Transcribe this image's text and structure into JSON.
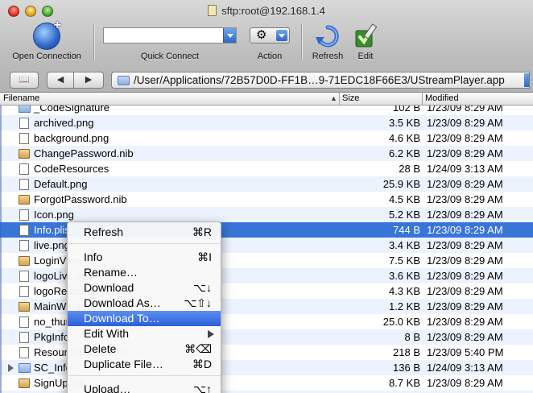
{
  "window": {
    "title": "sftp:root@192.168.1.4"
  },
  "toolbar": {
    "open_connection": "Open Connection",
    "quick_connect": "Quick Connect",
    "quick_connect_value": "",
    "action": "Action",
    "refresh": "Refresh",
    "edit": "Edit"
  },
  "pathbar": {
    "path": "/User/Applications/72B57D0D-FF1B…9-71EDC18F66E3/UStreamPlayer.app"
  },
  "columns": {
    "filename": "Filename",
    "size": "Size",
    "modified": "Modified"
  },
  "files": [
    {
      "name": "_CodeSignature",
      "size": "102 B",
      "modified": "1/23/09 8:29 AM",
      "kind": "folder"
    },
    {
      "name": "archived.png",
      "size": "3.5 KB",
      "modified": "1/23/09 8:29 AM",
      "kind": "file"
    },
    {
      "name": "background.png",
      "size": "4.6 KB",
      "modified": "1/23/09 8:29 AM",
      "kind": "file"
    },
    {
      "name": "ChangePassword.nib",
      "size": "6.2 KB",
      "modified": "1/23/09 8:29 AM",
      "kind": "nib"
    },
    {
      "name": "CodeResources",
      "size": "28 B",
      "modified": "1/24/09 3:13 AM",
      "kind": "file"
    },
    {
      "name": "Default.png",
      "size": "25.9 KB",
      "modified": "1/23/09 8:29 AM",
      "kind": "file"
    },
    {
      "name": "ForgotPassword.nib",
      "size": "4.5 KB",
      "modified": "1/23/09 8:29 AM",
      "kind": "nib"
    },
    {
      "name": "Icon.png",
      "size": "5.2 KB",
      "modified": "1/23/09 8:29 AM",
      "kind": "file"
    },
    {
      "name": "Info.plist",
      "size": "744 B",
      "modified": "1/23/09 8:29 AM",
      "kind": "file",
      "selected": true
    },
    {
      "name": "live.png",
      "size": "3.4 KB",
      "modified": "1/23/09 8:29 AM",
      "kind": "file"
    },
    {
      "name": "LoginView.nib",
      "size": "7.5 KB",
      "modified": "1/23/09 8:29 AM",
      "kind": "nib"
    },
    {
      "name": "logoLive.png",
      "size": "3.6 KB",
      "modified": "1/23/09 8:29 AM",
      "kind": "file"
    },
    {
      "name": "logoRecorded.png",
      "size": "4.3 KB",
      "modified": "1/23/09 8:29 AM",
      "kind": "file"
    },
    {
      "name": "MainWindow.nib",
      "size": "1.2 KB",
      "modified": "1/23/09 8:29 AM",
      "kind": "nib"
    },
    {
      "name": "no_thumbnail.png",
      "size": "25.0 KB",
      "modified": "1/23/09 8:29 AM",
      "kind": "file"
    },
    {
      "name": "PkgInfo",
      "size": "8 B",
      "modified": "1/23/09 8:29 AM",
      "kind": "file"
    },
    {
      "name": "ResourceRules.plist",
      "size": "218 B",
      "modified": "1/23/09 5:40 PM",
      "kind": "file"
    },
    {
      "name": "SC_Info",
      "size": "136 B",
      "modified": "1/24/09 3:13 AM",
      "kind": "folder",
      "disclosure": true
    },
    {
      "name": "SignUp.nib",
      "size": "8.7 KB",
      "modified": "1/23/09 8:29 AM",
      "kind": "nib"
    },
    {
      "name": "",
      "size": "",
      "modified": "",
      "kind": "file"
    }
  ],
  "context_menu": {
    "items": [
      {
        "label": "Refresh",
        "shortcut": "⌘R"
      },
      {
        "label": "Info",
        "shortcut": "⌘I"
      },
      {
        "label": "Rename…",
        "shortcut": ""
      },
      {
        "label": "Download",
        "shortcut": "⌥↓"
      },
      {
        "label": "Download As…",
        "shortcut": "⌥⇧↓"
      },
      {
        "label": "Download To…",
        "shortcut": "",
        "highlighted": true
      },
      {
        "label": "Edit With",
        "shortcut": "",
        "submenu": true
      },
      {
        "label": "Delete",
        "shortcut": "⌘⌫"
      },
      {
        "label": "Duplicate File…",
        "shortcut": "⌘D"
      },
      {
        "label": "Upload…",
        "shortcut": "⌥↑"
      }
    ]
  },
  "colors": {
    "selection": "#3875d7",
    "alt_row": "#edf3fe",
    "menu_highlight": "#3d72e3"
  }
}
